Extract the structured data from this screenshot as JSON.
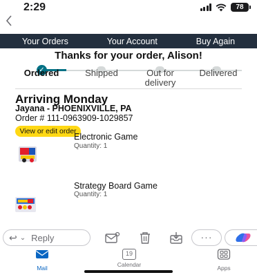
{
  "status_bar": {
    "time": "2:29",
    "battery": "78"
  },
  "nav": {
    "back_icon": "chevron-left-icon"
  },
  "amazon_nav": {
    "items": [
      "Your Orders",
      "Your Account",
      "Buy Again"
    ]
  },
  "heading": "Thanks for your order, Alison!",
  "tracker": {
    "steps": [
      {
        "label": "Ordered",
        "active": true
      },
      {
        "label": "Shipped",
        "active": false
      },
      {
        "label": "Out for delivery",
        "active": false
      },
      {
        "label": "Delivered",
        "active": false
      }
    ]
  },
  "shipment": {
    "arriving": "Arriving Monday",
    "ship_to": "Jayana - PHOENIXVILLE, PA",
    "order_number": "Order # 111-0963909-1029857",
    "view_edit_label": "View or edit order"
  },
  "items": [
    {
      "title": "Electronic Game",
      "quantity": "Quantity: 1"
    },
    {
      "title": "Strategy Board Game",
      "quantity": "Quantity: 1"
    }
  ],
  "toolbar": {
    "reply_label": "Reply",
    "more_label": "···"
  },
  "tabbar": {
    "items": [
      {
        "label": "Mail",
        "icon": "mail-icon",
        "active": true
      },
      {
        "label": "Calendar",
        "icon": "calendar-icon",
        "day": "19",
        "active": false
      },
      {
        "label": "Apps",
        "icon": "apps-icon",
        "active": false
      }
    ]
  },
  "colors": {
    "amazon_nav_bg": "#232f3e",
    "tracker_teal": "#007185",
    "button_yellow": "#ffd814",
    "outlook_blue": "#0a66c2"
  }
}
